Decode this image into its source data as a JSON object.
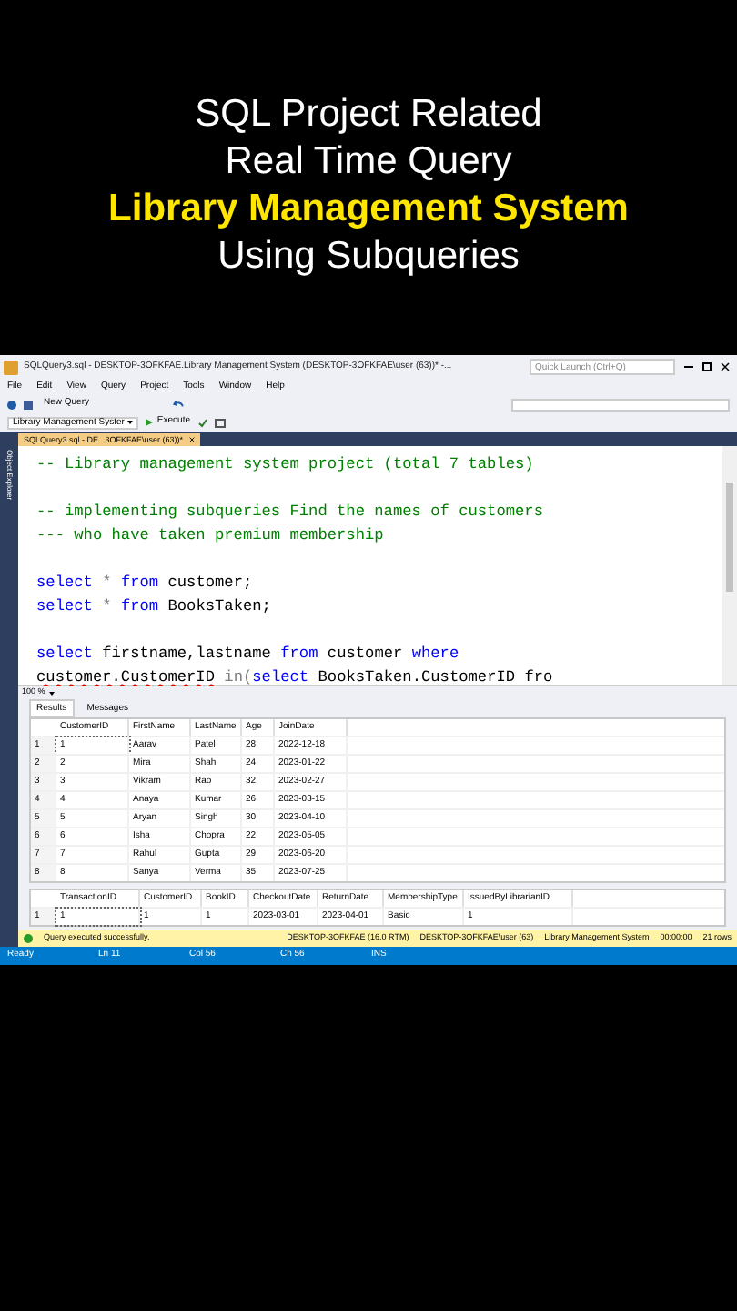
{
  "headline": [
    {
      "text": "SQL Project Related",
      "highlight": false
    },
    {
      "text": "Real Time Query",
      "highlight": false
    },
    {
      "text": "Library Management System",
      "highlight": true
    },
    {
      "text": "Using Subqueries",
      "highlight": false
    }
  ],
  "window": {
    "title": "SQLQuery3.sql - DESKTOP-3OFKFAE.Library Management System (DESKTOP-3OFKFAE\\user (63))* -...",
    "quick_launch": {
      "placeholder": "Quick Launch (Ctrl+Q)"
    }
  },
  "menu": [
    "File",
    "Edit",
    "View",
    "Query",
    "Project",
    "Tools",
    "Window",
    "Help"
  ],
  "toolbar": {
    "new_query": "New Query",
    "database": "Library Management Syster",
    "execute": "Execute"
  },
  "document_tab": {
    "title": "SQLQuery3.sql - DE...3OFKFAE\\user (63))*",
    "selected": true
  },
  "side_panel": "Object Explorer",
  "editor": {
    "blocks": [
      [
        [
          {
            "kind": "comment",
            "text": "-- Library management system project (total 7 tables)"
          }
        ]
      ],
      [
        [
          {
            "kind": "comment",
            "text": "-- implementing subqueries Find the names of customers"
          }
        ],
        [
          {
            "kind": "comment",
            "text": "--- who have taken premium membership"
          }
        ]
      ],
      [
        [
          {
            "kind": "keyword",
            "text": "select"
          },
          {
            "kind": "operator",
            "text": " * "
          },
          {
            "kind": "keyword",
            "text": "from"
          },
          {
            "kind": "plain",
            "text": " customer;"
          }
        ],
        [
          {
            "kind": "keyword",
            "text": "select"
          },
          {
            "kind": "operator",
            "text": " * "
          },
          {
            "kind": "keyword",
            "text": "from"
          },
          {
            "kind": "plain",
            "text": " BooksTaken;"
          }
        ]
      ],
      [
        [
          {
            "kind": "keyword",
            "text": "select"
          },
          {
            "kind": "plain",
            "text": " firstname,lastname "
          },
          {
            "kind": "keyword",
            "text": "from"
          },
          {
            "kind": "plain",
            "text": " customer "
          },
          {
            "kind": "keyword",
            "text": "where"
          }
        ],
        [
          {
            "kind": "error",
            "text": "customer.CustomerID"
          },
          {
            "kind": "operator",
            "text": " in("
          },
          {
            "kind": "keyword",
            "text": "select"
          },
          {
            "kind": "plain",
            "text": " BooksTaken.CustomerID fro"
          }
        ]
      ]
    ],
    "zoom": "100 %"
  },
  "results_tabs": [
    {
      "label": "Results",
      "selected": true
    },
    {
      "label": "Messages",
      "selected": false
    }
  ],
  "grids": [
    {
      "columns": [
        "",
        "CustomerID",
        "FirstName",
        "LastName",
        "Age",
        "JoinDate"
      ],
      "rows": [
        [
          "1",
          "1",
          "Aarav",
          "Patel",
          "28",
          "2022-12-18"
        ],
        [
          "2",
          "2",
          "Mira",
          "Shah",
          "24",
          "2023-01-22"
        ],
        [
          "3",
          "3",
          "Vikram",
          "Rao",
          "32",
          "2023-02-27"
        ],
        [
          "4",
          "4",
          "Anaya",
          "Kumar",
          "26",
          "2023-03-15"
        ],
        [
          "5",
          "5",
          "Aryan",
          "Singh",
          "30",
          "2023-04-10"
        ],
        [
          "6",
          "6",
          "Isha",
          "Chopra",
          "22",
          "2023-05-05"
        ],
        [
          "7",
          "7",
          "Rahul",
          "Gupta",
          "29",
          "2023-06-20"
        ],
        [
          "8",
          "8",
          "Sanya",
          "Verma",
          "35",
          "2023-07-25"
        ]
      ]
    },
    {
      "columns": [
        "",
        "TransactionID",
        "CustomerID",
        "BookID",
        "CheckoutDate",
        "ReturnDate",
        "MembershipType",
        "IssuedByLibrarianID"
      ],
      "rows": [
        [
          "1",
          "1",
          "1",
          "1",
          "2023-03-01",
          "2023-04-01",
          "Basic",
          "1"
        ]
      ]
    }
  ],
  "query_status": {
    "message": "Query executed successfully.",
    "server": "DESKTOP-3OFKFAE (16.0 RTM)",
    "user": "DESKTOP-3OFKFAE\\user (63)",
    "database": "Library Management System",
    "time": "00:00:00",
    "rows": "21 rows"
  },
  "status_bar": [
    "Ready",
    "Ln 11",
    "Col 56",
    "Ch 56",
    "INS"
  ]
}
